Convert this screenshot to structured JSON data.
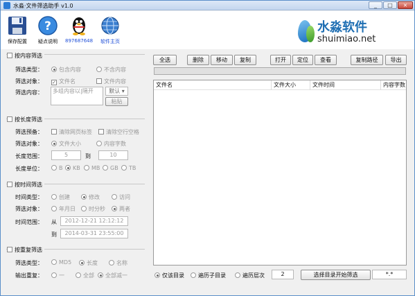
{
  "window": {
    "title": "水淼·文件筛选助手 v1.0",
    "min": "_",
    "max": "□",
    "close": "×"
  },
  "toolbar": {
    "items": [
      {
        "label": "保存配置",
        "icon": "save-icon"
      },
      {
        "label": "疑点说明",
        "icon": "help-icon"
      },
      {
        "label": "897687648",
        "icon": "qq-penguin-icon",
        "color": "#1f4fd8"
      },
      {
        "label": "软件主页",
        "icon": "globe-icon",
        "color": "#1f4fd8"
      }
    ]
  },
  "logo": {
    "cn": "水淼软件",
    "en": "shuimiao.net"
  },
  "content_filter": {
    "title": "按内容筛选",
    "type_label": "筛选类型：",
    "type_opts": [
      "包含内容",
      "不含内容"
    ],
    "obj_label": "筛选对象：",
    "obj_opts": [
      "文件名",
      "文件内容"
    ],
    "content_label": "筛选内容：",
    "placeholder": "多组内容以|隔开",
    "default_label": "默认",
    "paste_label": "粘贴"
  },
  "length_filter": {
    "title": "按长度筛选",
    "pre_label": "筛选预备：",
    "pre_opts": [
      "清除网页标签",
      "清除空行空格"
    ],
    "obj_label": "筛选对象：",
    "obj_opts": [
      "文件大小",
      "内容字数"
    ],
    "range_label": "长度范围：",
    "min": "5",
    "to": "到",
    "max": "10",
    "unit_label": "长度单位：",
    "units": [
      "B",
      "KB",
      "MB",
      "GB",
      "TB"
    ]
  },
  "time_filter": {
    "title": "按时间筛选",
    "type_label": "时间类型：",
    "type_opts": [
      "创建",
      "修改",
      "访问"
    ],
    "obj_label": "筛选对象：",
    "obj_opts": [
      "年月日",
      "时分秒",
      "两者"
    ],
    "range_label": "时间范围：",
    "from": "从",
    "from_val": "2012-12-21 12:12:12",
    "to": "到",
    "to_val": "2014-03-31 23:55:00"
  },
  "dup_filter": {
    "title": "按重复筛选",
    "type_label": "筛选类型：",
    "type_opts": [
      "MD5",
      "长度",
      "名称"
    ],
    "out_label": "输出重复：",
    "out_opts": [
      "一",
      "全部",
      "全部减一"
    ]
  },
  "actions": {
    "select_all": "全选",
    "delete": "删除",
    "move": "移动",
    "copy": "复制",
    "open": "打开",
    "locate": "定位",
    "view": "查看",
    "copy_path": "复制路径",
    "export": "导出"
  },
  "table": {
    "columns": [
      "文件名",
      "文件大小",
      "文件时间",
      "内容字数"
    ]
  },
  "bottom": {
    "opts": [
      "仅该目录",
      "遍历子目录",
      "遍历层次"
    ],
    "depth": "2",
    "start": "选择目录开始筛选",
    "pattern": "*.*"
  }
}
